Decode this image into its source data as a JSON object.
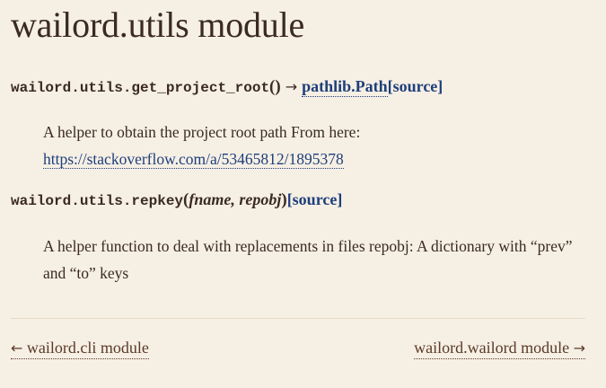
{
  "page": {
    "title": "wailord.utils module"
  },
  "functions": [
    {
      "name": "wailord.utils.get_project_root",
      "parens": "()",
      "arrow": "→",
      "return_type": "pathlib.Path",
      "source_label": "[source]",
      "description_text": "A helper to obtain the project root path From here:",
      "description_link": "https://stackoverflow.com/a/53465812/1895378"
    },
    {
      "name": "wailord.utils.repkey",
      "open_paren": "(",
      "params": "fname, repobj",
      "close_paren": ")",
      "source_label": "[source]",
      "description_text": "A helper function to deal with replacements in files repobj: A dictionary with “prev” and “to” keys"
    }
  ],
  "navigation": {
    "prev_arrow": "←",
    "prev_label": "wailord.cli module",
    "next_label": "wailord.wailord module",
    "next_arrow": "→"
  }
}
